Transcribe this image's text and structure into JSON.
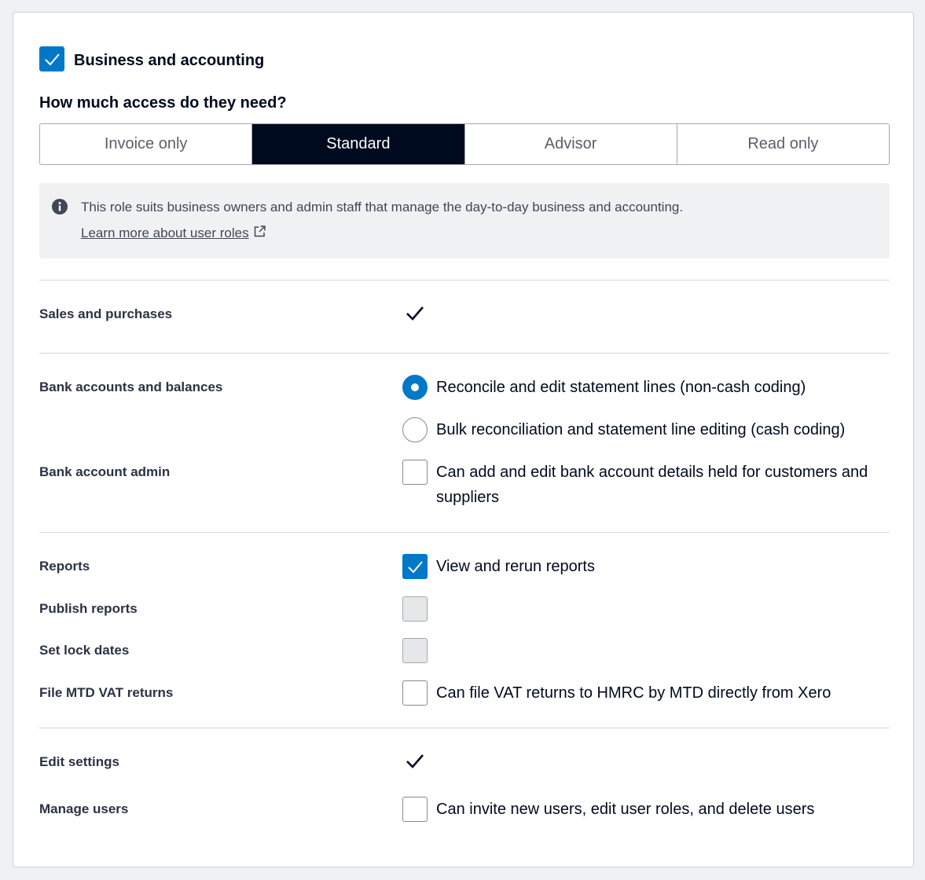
{
  "section": {
    "title": "Business and accounting",
    "checked": true
  },
  "access": {
    "question": "How much access do they need?",
    "options": [
      "Invoice only",
      "Standard",
      "Advisor",
      "Read only"
    ],
    "selected": "Standard"
  },
  "info": {
    "text": "This role suits business owners and admin staff that manage the day-to-day business and accounting.",
    "link": "Learn more about user roles"
  },
  "permissions": {
    "sales": {
      "label": "Sales and purchases",
      "granted": true
    },
    "bank": {
      "label": "Bank accounts and balances",
      "radio_options": [
        {
          "label": "Reconcile and edit statement lines (non-cash coding)",
          "selected": true
        },
        {
          "label": "Bulk reconciliation and statement line editing (cash coding)",
          "selected": false
        }
      ]
    },
    "bank_admin": {
      "label": "Bank account admin",
      "checkbox_text_line1": "Can add and edit bank account details held for customers and",
      "checkbox_text_line2": "suppliers",
      "checked": false
    },
    "reports": {
      "label": "Reports",
      "checkbox_text": "View and rerun reports",
      "checked": true
    },
    "publish_reports": {
      "label": "Publish reports",
      "checked": false,
      "disabled": true
    },
    "lock_dates": {
      "label": "Set lock dates",
      "checked": false,
      "disabled": true
    },
    "mtd_vat": {
      "label": "File MTD VAT returns",
      "checkbox_text": "Can file VAT returns to HMRC by MTD directly from Xero",
      "checked": false
    },
    "edit_settings": {
      "label": "Edit settings",
      "granted": true
    },
    "manage_users": {
      "label": "Manage users",
      "checkbox_text": "Can invite new users, edit user roles, and delete users",
      "checked": false
    }
  },
  "colors": {
    "accent": "#0078c8",
    "selected_segment": "#000a1e",
    "info_bg": "#eff1f3"
  }
}
